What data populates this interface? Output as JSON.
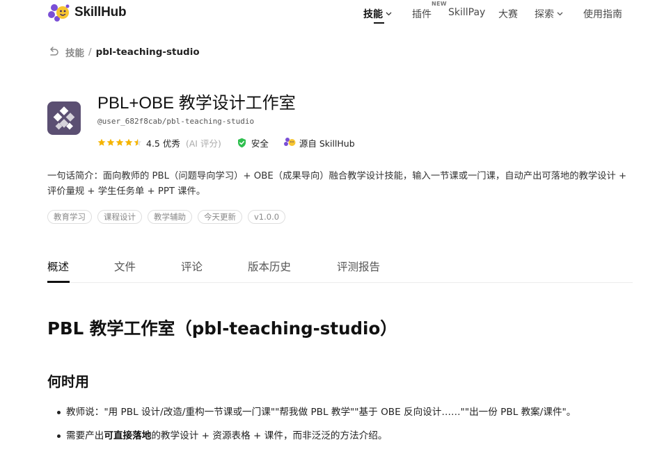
{
  "header": {
    "brand": "SkillHub",
    "nav": {
      "skills": "技能",
      "plugins": "插件",
      "plugins_badge": "NEW",
      "skillpay": "SkillPay",
      "contest": "大赛",
      "explore": "探索",
      "guide": "使用指南"
    }
  },
  "breadcrumb": {
    "parent": "技能",
    "separator": "/",
    "current": "pbl-teaching-studio"
  },
  "skill": {
    "title": "PBL+OBE 教学设计工作室",
    "path": "@user_682f8cab/pbl-teaching-studio",
    "rating_text": "4.5 优秀",
    "rating_value": 4.5,
    "rating_max": 5,
    "rating_source": "(AI 评分)",
    "safety": "安全",
    "source": "源自 SkillHub",
    "description": "一句话简介：面向教师的 PBL（问题导向学习）+ OBE（成果导向）融合教学设计技能，输入一节课或一门课，自动产出可落地的教学设计 + 评价量规 + 学生任务单 + PPT 课件。",
    "tags": [
      "教育学习",
      "课程设计",
      "教学辅助",
      "今天更新",
      "v1.0.0"
    ]
  },
  "tabs": [
    "概述",
    "文件",
    "评论",
    "版本历史",
    "评测报告"
  ],
  "content": {
    "heading": "PBL 教学工作室（pbl-teaching-studio）",
    "subheading": "何时用",
    "bullet1": "教师说：\"用 PBL 设计/改造/重构一节课或一门课\"\"帮我做 PBL 教学\"\"基于 OBE 反向设计……\"\"出一份 PBL 教案/课件\"。",
    "bullet2_prefix": "需要产出",
    "bullet2_bold": "可直接落地",
    "bullet2_suffix": "的教学设计 + 资源表格 + 课件，而非泛泛的方法介绍。"
  },
  "colors": {
    "star": "#f5b400",
    "shield": "#2fbf4f",
    "icon_bg": "#5b4f72",
    "brand_purple": "#7a4fd6",
    "brand_yellow": "#f7c531"
  }
}
